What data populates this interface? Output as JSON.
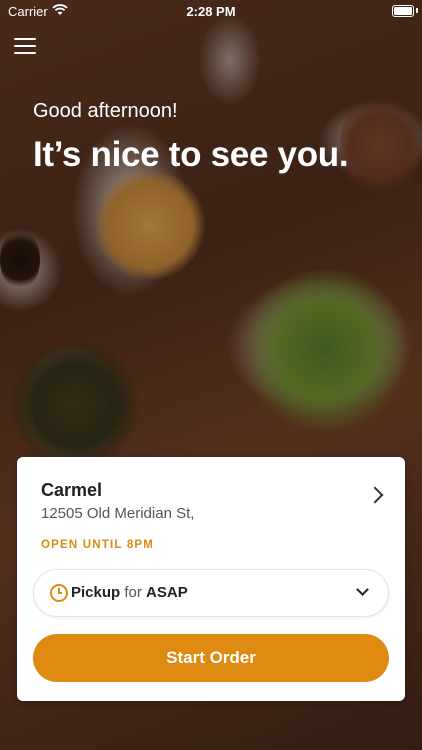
{
  "status_bar": {
    "carrier": "Carrier",
    "time": "2:28 PM"
  },
  "header": {
    "greeting": "Good afternoon!",
    "welcome": "It’s nice to see you."
  },
  "location": {
    "name": "Carmel",
    "address": "12505 Old Meridian St,",
    "hours": "OPEN UNTIL 8PM"
  },
  "order_mode": {
    "mode": "Pickup",
    "connector": "for",
    "time": "ASAP"
  },
  "actions": {
    "start_order": "Start Order"
  },
  "colors": {
    "accent": "#df8a10",
    "hours_text": "#d98b14"
  },
  "icons": [
    "menu-icon",
    "wifi-icon",
    "battery-icon",
    "clock-icon",
    "chevron-right-icon",
    "chevron-down-icon"
  ]
}
